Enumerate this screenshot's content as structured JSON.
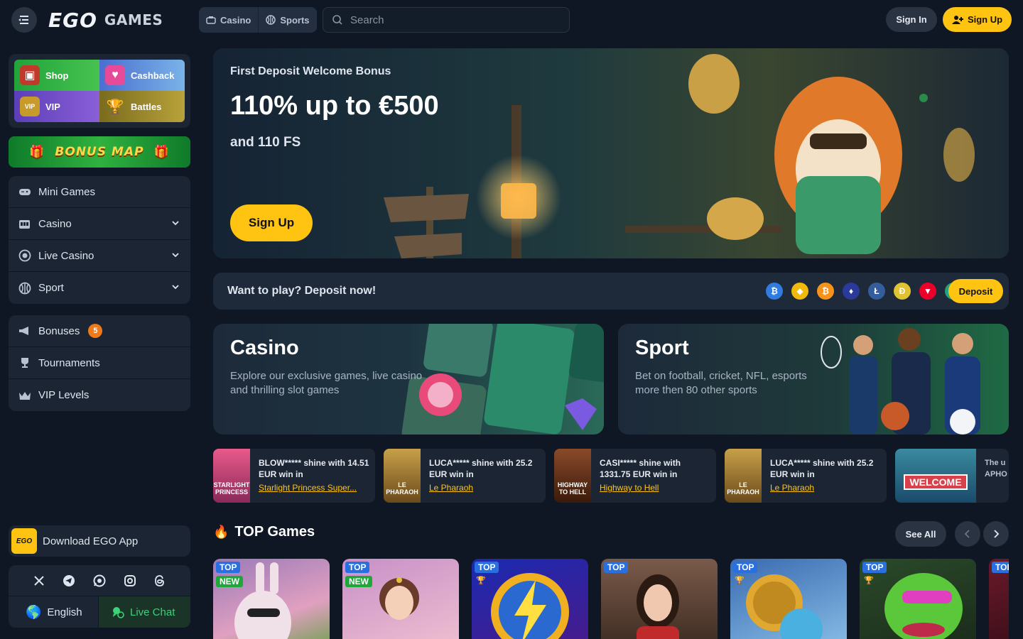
{
  "header": {
    "logo_main": "EGO",
    "logo_sub": "GAMES",
    "tabs": [
      {
        "label": "Casino"
      },
      {
        "label": "Sports"
      }
    ],
    "search_placeholder": "Search",
    "signin_label": "Sign In",
    "signup_label": "Sign Up"
  },
  "sidebar": {
    "quick": [
      {
        "label": "Shop"
      },
      {
        "label": "Cashback"
      },
      {
        "label": "VIP"
      },
      {
        "label": "Battles"
      }
    ],
    "bonus_map_label": "BONUS MAP",
    "groups": [
      {
        "label": "Mini Games"
      },
      {
        "label": "Casino"
      },
      {
        "label": "Live Casino"
      },
      {
        "label": "Sport"
      }
    ],
    "extras": [
      {
        "label": "Bonuses",
        "badge": "5"
      },
      {
        "label": "Tournaments"
      },
      {
        "label": "VIP Levels"
      }
    ],
    "download_label": "Download EGO App",
    "app_icon_text": "EGO",
    "language": "English",
    "live_chat": "Live Chat"
  },
  "hero": {
    "subtitle": "First Deposit Welcome Bonus",
    "title": "110% up to €500",
    "free_spins": "and 110 FS",
    "button": "Sign Up"
  },
  "deposit": {
    "text": "Want to play? Deposit now!",
    "button": "Deposit",
    "coins": [
      {
        "name": "bitcoin-blue",
        "color": "#2f7be0",
        "glyph": "₿"
      },
      {
        "name": "binance",
        "color": "#f0b90b",
        "glyph": "◆"
      },
      {
        "name": "bitcoin",
        "color": "#f7931a",
        "glyph": "₿"
      },
      {
        "name": "blaze",
        "color": "#2a3a9a",
        "glyph": "♦"
      },
      {
        "name": "litecoin",
        "color": "#345d9d",
        "glyph": "Ł"
      },
      {
        "name": "dogecoin",
        "color": "#e1c233",
        "glyph": "Ð"
      },
      {
        "name": "tron",
        "color": "#eb0029",
        "glyph": "▼"
      },
      {
        "name": "tether",
        "color": "#26a17b",
        "glyph": "₮"
      },
      {
        "name": "cardano",
        "color": "#2a5ada",
        "glyph": "✲"
      }
    ]
  },
  "promos": {
    "casino": {
      "title": "Casino",
      "desc": "Explore our exclusive games, live casino and thrilling slot games"
    },
    "sport": {
      "title": "Sport",
      "desc": "Bet on football, cricket, NFL, esports more then 80 other sports"
    }
  },
  "wins": [
    {
      "text": "BLOW***** shine with 14.51 EUR win in",
      "game": "Starlight Princess Super...",
      "thumb": "STARLIGHT PRINCESS",
      "color": "#c04a7a"
    },
    {
      "text": "LUCA***** shine with 25.2 EUR win in",
      "game": "Le Pharaoh",
      "thumb": "LE PHARAOH",
      "color": "#8a6a2a"
    },
    {
      "text": "CASI***** shine with 1331.75 EUR win in",
      "game": "Highway to Hell",
      "thumb": "HIGHWAY TO HELL",
      "color": "#5a2a1a"
    },
    {
      "text": "LUCA***** shine with 25.2 EUR win in",
      "game": "Le Pharaoh",
      "thumb": "LE PHARAOH",
      "color": "#8a6a2a"
    },
    {
      "text": "The u APHO",
      "game": "",
      "thumb": "WELCOME",
      "color": "#2a6a8a"
    }
  ],
  "top_games": {
    "title": "TOP Games",
    "see_all": "See All",
    "tag_top": "TOP",
    "tag_new": "NEW",
    "cards": [
      {
        "color": "#7a5a9a",
        "new": true
      },
      {
        "color": "#b07a9a",
        "new": true
      },
      {
        "color": "#3a2aa0",
        "new": false
      },
      {
        "color": "#5a3a2a",
        "new": false
      },
      {
        "color": "#3a6ab0",
        "new": false
      },
      {
        "color": "#2a5a2a",
        "new": false
      },
      {
        "color": "#6a1a2a",
        "new": false
      }
    ]
  },
  "colors": {
    "accent": "#ffc412",
    "background": "#0f1724",
    "panel": "#1c2534",
    "live_chat": "#3fd07a"
  }
}
